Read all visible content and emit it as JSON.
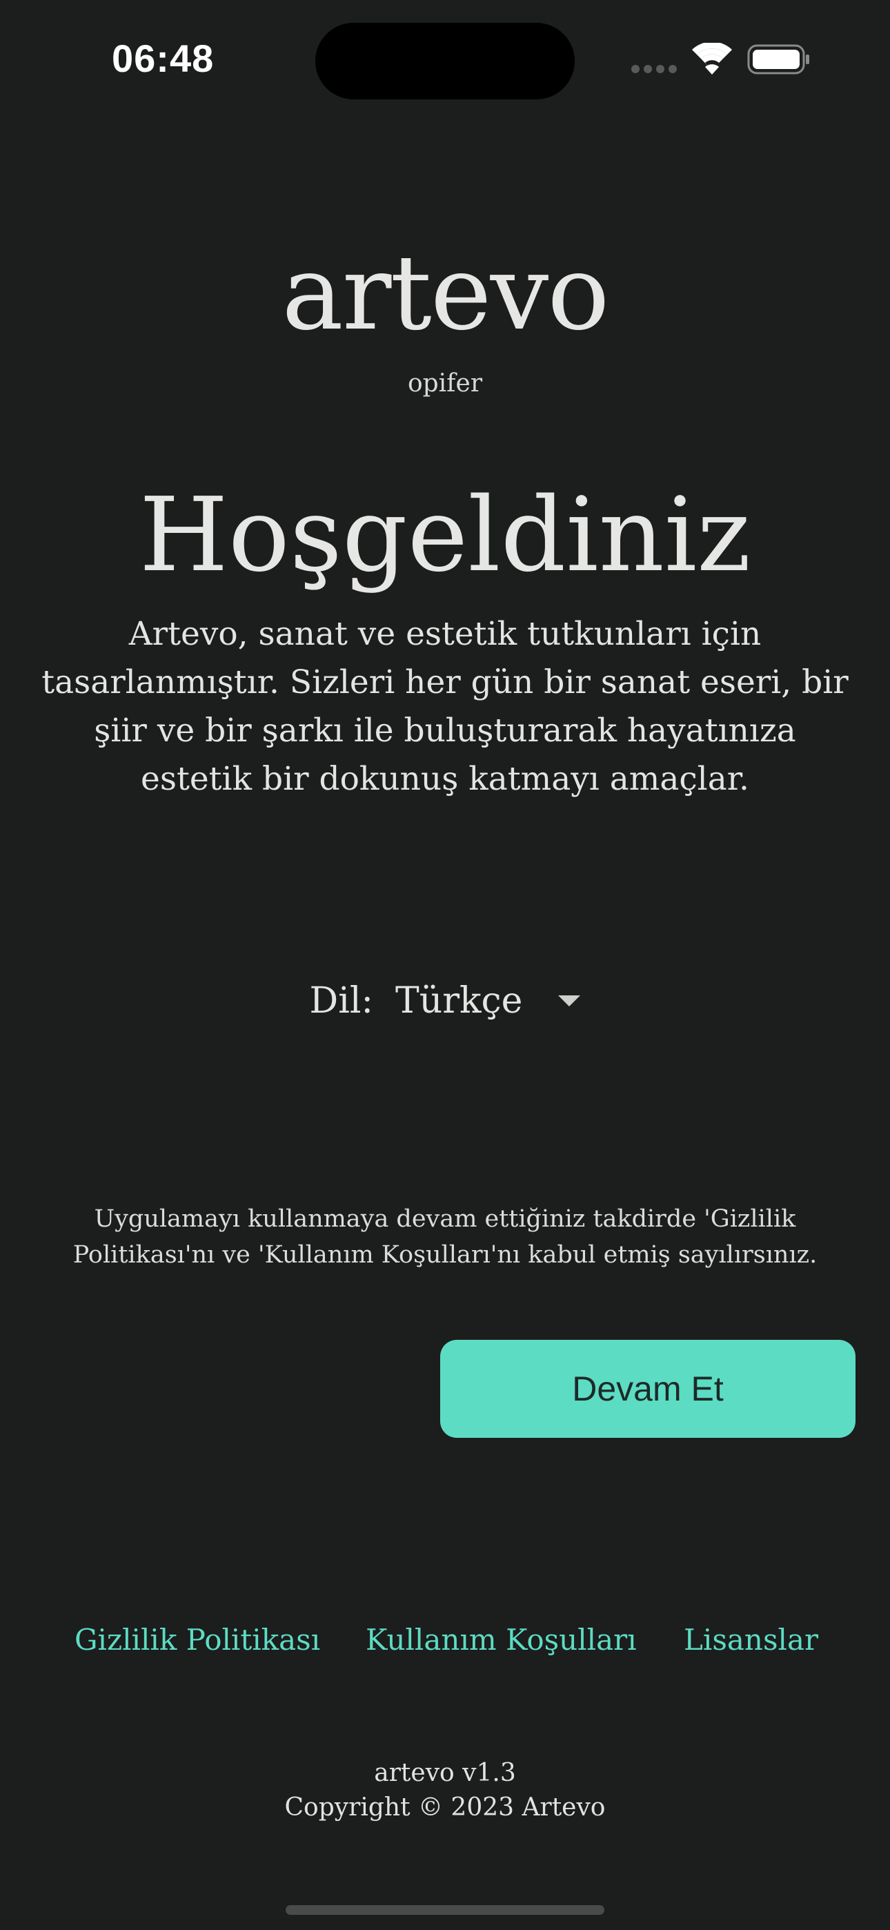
{
  "status_bar": {
    "time": "06:48",
    "signal": "signal-dots-icon",
    "wifi": "wifi-icon",
    "battery": "battery-full-icon"
  },
  "header": {
    "logo": "artevo",
    "subtitle": "opifer"
  },
  "welcome": {
    "title": "Hoşgeldiniz",
    "description_lines": [
      "Artevo, sanat ve estetik tutkunları için",
      "tasarlanmıştır. Sizleri her gün bir sanat eseri, bir",
      "şiir ve bir şarkı ile buluşturarak hayatınıza",
      "estetik bir dokunuş katmayı amaçlar."
    ]
  },
  "language": {
    "label": "Dil:",
    "selected": "Türkçe"
  },
  "consent": {
    "lines": [
      "Uygulamayı kullanmaya devam ettiğiniz takdirde 'Gizlilik",
      "Politikası'nı ve 'Kullanım Koşulları'nı kabul etmiş sayılırsınız."
    ]
  },
  "actions": {
    "continue_label": "Devam Et"
  },
  "footer": {
    "links": [
      "Gizlilik Politikası",
      "Kullanım Koşulları",
      "Lisanslar"
    ],
    "version": "artevo v1.3",
    "copyright": "Copyright © 2023 Artevo"
  },
  "colors": {
    "background": "#1c1d1d",
    "accent": "#5cdcc3",
    "text": "#e6e6e4"
  }
}
